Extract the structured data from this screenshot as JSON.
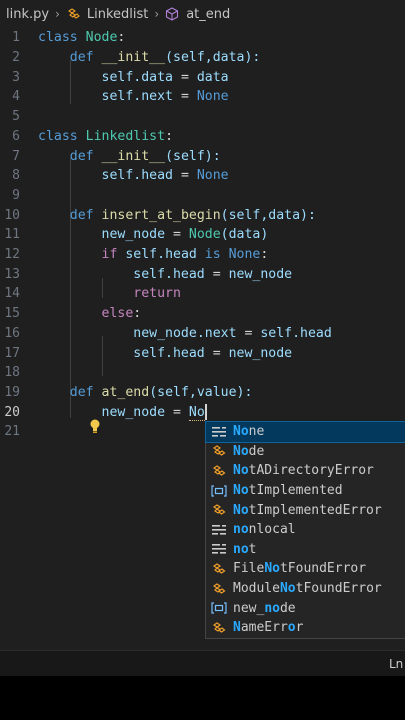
{
  "breadcrumb": {
    "file": "link.py",
    "class": "Linkedlist",
    "method": "at_end"
  },
  "code": {
    "l1": {
      "num": "1",
      "kw": "class",
      "name": "Node",
      "punct": ":"
    },
    "l2": {
      "num": "2",
      "kw": "def",
      "name": "__init__",
      "params": "(self,data):"
    },
    "l3": {
      "num": "3",
      "obj": "self",
      "attr": ".data",
      "eq": " = ",
      "val": "data"
    },
    "l4": {
      "num": "4",
      "obj": "self",
      "attr": ".next",
      "eq": " = ",
      "val": "None"
    },
    "l5": {
      "num": "5"
    },
    "l6": {
      "num": "6",
      "kw": "class",
      "name": "Linkedlist",
      "punct": ":"
    },
    "l7": {
      "num": "7",
      "kw": "def",
      "name": "__init__",
      "params": "(self):"
    },
    "l8": {
      "num": "8",
      "obj": "self",
      "attr": ".head",
      "eq": " = ",
      "val": "None"
    },
    "l9": {
      "num": "9"
    },
    "l10": {
      "num": "10",
      "kw": "def",
      "name": "insert_at_begin",
      "params": "(self,data):"
    },
    "l11": {
      "num": "11",
      "var": "new_node",
      "eq": " = ",
      "cls": "Node",
      "args": "(data)"
    },
    "l12": {
      "num": "12",
      "kw": "if",
      "obj": " self",
      "attr": ".head ",
      "op": "is",
      "val": " None",
      "punct": ":"
    },
    "l13": {
      "num": "13",
      "obj": "self",
      "attr": ".head",
      "eq": " = ",
      "val": "new_node"
    },
    "l14": {
      "num": "14",
      "kw": "return"
    },
    "l15": {
      "num": "15",
      "kw": "else",
      "punct": ":"
    },
    "l16": {
      "num": "16",
      "var": "new_node",
      "attr": ".next",
      "eq": " = ",
      "obj": "self",
      "attr2": ".head"
    },
    "l17": {
      "num": "17",
      "obj": "self",
      "attr": ".head",
      "eq": " = ",
      "val": "new_node"
    },
    "l18": {
      "num": "18"
    },
    "l19": {
      "num": "19",
      "kw": "def",
      "name": "at_end",
      "params": "(self,value):"
    },
    "l20": {
      "num": "20",
      "var": "new_node",
      "eq": " = ",
      "typed": "No"
    },
    "l21": {
      "num": "21"
    }
  },
  "suggestions": [
    {
      "match": "No",
      "rest": "ne",
      "icon": "keyword-icon",
      "selected": true
    },
    {
      "match": "No",
      "rest": "de",
      "icon": "class-icon"
    },
    {
      "match": "No",
      "rest": "tADirectoryError",
      "icon": "class-icon"
    },
    {
      "match": "No",
      "rest": "tImplemented",
      "icon": "variable-icon"
    },
    {
      "match": "No",
      "rest": "tImplementedError",
      "icon": "class-icon"
    },
    {
      "match": "no",
      "rest": "nlocal",
      "icon": "keyword-icon"
    },
    {
      "match": "no",
      "rest": "t",
      "icon": "keyword-icon"
    },
    {
      "pre": "File",
      "match": "No",
      "rest": "tFoundError",
      "icon": "class-icon"
    },
    {
      "pre": "Module",
      "match": "No",
      "rest": "tFoundError",
      "icon": "class-icon"
    },
    {
      "pre": "new_",
      "match": "no",
      "rest": "de",
      "icon": "variable-icon"
    },
    {
      "pre": "",
      "match": "N",
      "rest": "ameErr",
      "match2": "o",
      "rest2": "r",
      "icon": "class-icon"
    }
  ],
  "status": {
    "right_text": "Ln"
  },
  "colors": {
    "accent": "#04395e",
    "match": "#2aaaff",
    "background": "#1f1f1f"
  }
}
